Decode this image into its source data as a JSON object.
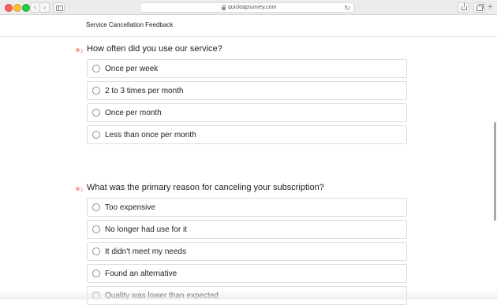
{
  "browser": {
    "url": "quicktapsurvey.com",
    "reload_glyph": "↻",
    "back_glyph": "‹",
    "forward_glyph": "›",
    "new_tab_glyph": "+"
  },
  "page": {
    "title": "Service Cancellation Feedback"
  },
  "questions": [
    {
      "text": "How often did you use our service?",
      "options": [
        "Once per week",
        "2 to 3 times per month",
        "Once per month",
        "Less than once per month"
      ]
    },
    {
      "text": "What was the primary reason for canceling your subscription?",
      "options": [
        "Too expensive",
        "No longer had use for it",
        "It didn't meet my needs",
        "Found an alternative",
        "Quality was lower than expected"
      ]
    }
  ],
  "colors": {
    "required_marker": "#f3a69b",
    "option_border": "#dddddd",
    "radio_border": "#8c8c8c"
  },
  "icons": {
    "required": "required-indicator-icon",
    "radio": "radio-unchecked-icon",
    "lock": "lock-icon",
    "reload": "reload-icon",
    "share": "share-icon",
    "tabs": "tabs-icon",
    "sidebar": "sidebar-icon"
  }
}
